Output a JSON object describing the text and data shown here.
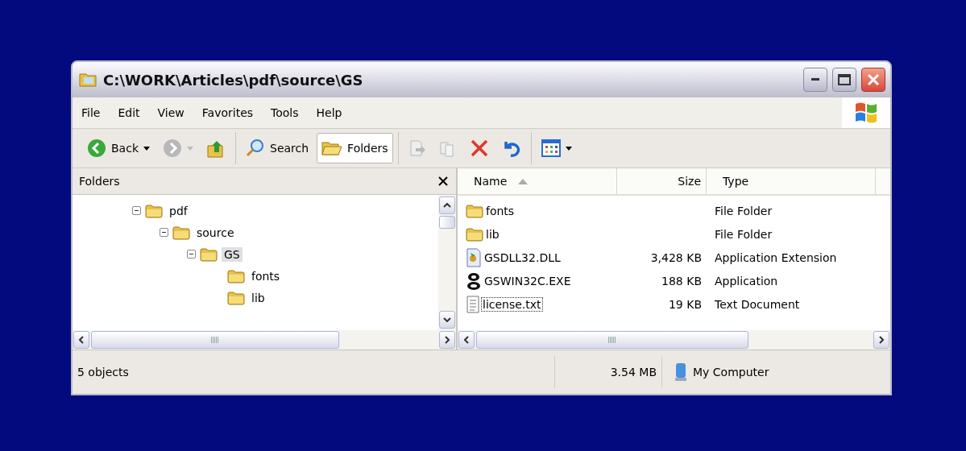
{
  "window": {
    "title": "C:\\WORK\\Articles\\pdf\\source\\GS"
  },
  "menu": [
    "File",
    "Edit",
    "View",
    "Favorites",
    "Tools",
    "Help"
  ],
  "toolbar": [
    [
      {
        "kind": "back",
        "label": "Back",
        "disabled": false,
        "dropdown": true
      },
      {
        "kind": "forward",
        "disabled": true,
        "dropdown": true
      },
      {
        "kind": "up",
        "disabled": false
      }
    ],
    [
      {
        "kind": "search",
        "label": "Search",
        "pressed": false
      },
      {
        "kind": "folders",
        "label": "Folders",
        "pressed": true
      }
    ],
    [
      {
        "kind": "move",
        "disabled": true
      },
      {
        "kind": "copy",
        "disabled": true
      },
      {
        "kind": "delete",
        "disabled": false
      },
      {
        "kind": "undo",
        "disabled": false
      }
    ],
    [
      {
        "kind": "views",
        "dropdown": true
      }
    ]
  ],
  "folders_pane": {
    "title": "Folders",
    "tree": [
      {
        "name": "pdf",
        "expanded": true,
        "selected": false,
        "children": [
          {
            "name": "source",
            "expanded": true,
            "selected": false,
            "children": [
              {
                "name": "GS",
                "expanded": true,
                "selected": true,
                "children": [
                  {
                    "name": "fonts",
                    "selected": false
                  },
                  {
                    "name": "lib",
                    "selected": false
                  }
                ]
              }
            ]
          }
        ]
      }
    ]
  },
  "file_list": {
    "columns": [
      {
        "label": "Name",
        "sorted": true
      },
      {
        "label": "Size",
        "sorted": false
      },
      {
        "label": "Type",
        "sorted": false
      }
    ],
    "rows": [
      {
        "kind": "folder",
        "name": "fonts",
        "type": "File Folder",
        "focused": false
      },
      {
        "kind": "folder",
        "name": "lib",
        "type": "File Folder",
        "focused": false
      },
      {
        "kind": "dll",
        "name": "GSDLL32.DLL",
        "size": "3,428 KB",
        "type": "Application Extension",
        "focused": false
      },
      {
        "kind": "exe",
        "name": "GSWIN32C.EXE",
        "size": "188 KB",
        "type": "Application",
        "focused": false
      },
      {
        "kind": "txt",
        "name": "license.txt",
        "size": "19 KB",
        "type": "Text Document",
        "focused": true
      }
    ]
  },
  "status_bar": {
    "objects": "5 objects",
    "size": "3.54 MB",
    "zone": "My Computer"
  }
}
